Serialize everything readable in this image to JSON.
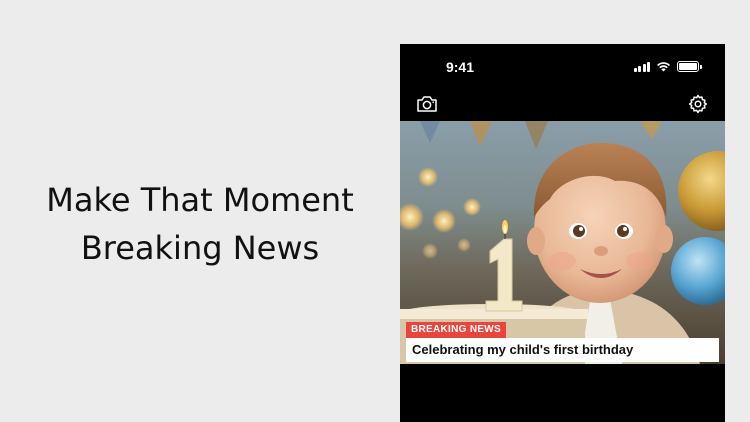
{
  "promo": {
    "line1": "Make That Moment",
    "line2": "Breaking News"
  },
  "status_bar": {
    "time": "9:41",
    "icons": [
      "signal-icon",
      "wifi-icon",
      "battery-icon"
    ]
  },
  "toolbar": {
    "left_icon": "camera-icon",
    "right_icon": "gear-icon"
  },
  "photo": {
    "description_icon": "birthday-photo"
  },
  "news_overlay": {
    "tag": "BREAKING NEWS",
    "caption": "Celebrating my child's first birthday",
    "tag_color": "#e8453c"
  },
  "colors": {
    "background": "#ececec",
    "phone": "#000000",
    "accent": "#e8453c"
  }
}
